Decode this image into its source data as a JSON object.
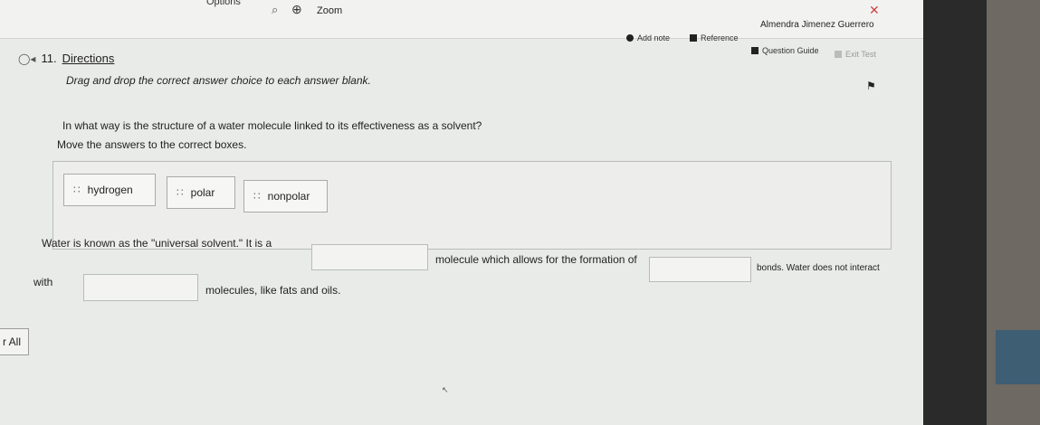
{
  "toolbar": {
    "options_label": "Options",
    "zoom_label": "Zoom",
    "user_name": "Almendra Jimenez Guerrero",
    "add_note_label": "Add note",
    "reference_label": "Reference",
    "question_guide_label": "Question Guide",
    "exit_test_label": "Exit Test"
  },
  "question": {
    "number": "11.",
    "directions_label": "Directions",
    "instruction": "Drag and drop the correct answer choice to each answer blank.",
    "prompt": "In what way is the structure of a water molecule linked to its effectiveness as a solvent?",
    "move_text": "Move the answers to the correct boxes."
  },
  "choices": [
    "hydrogen",
    "polar",
    "nonpolar"
  ],
  "sentence": {
    "part1": "Water is known as the \"universal solvent.\" It is a",
    "part2": "molecule which allows for the formation of",
    "part3": "bonds. Water does not interact",
    "part4": "with",
    "part5": "molecules, like fats and oils."
  },
  "footer": {
    "read_all_label": "r All"
  },
  "icons": {
    "zoom_out": "zoom-out-icon",
    "zoom_in": "zoom-in-icon",
    "close": "close-icon",
    "speaker": "speaker-icon",
    "flag": "flag-icon",
    "grip": "grip-icon"
  }
}
